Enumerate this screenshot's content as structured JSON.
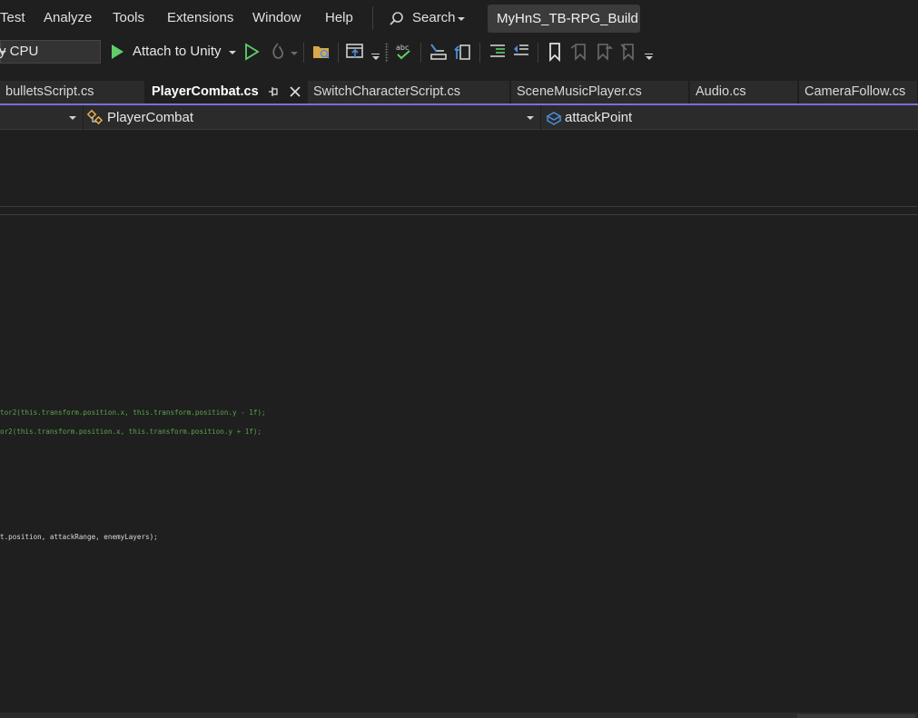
{
  "menubar": {
    "items": [
      "Test",
      "Analyze",
      "Tools",
      "Extensions",
      "Window",
      "Help"
    ],
    "search_label": "Search",
    "solution_name": "MyHnS_TB-RPG_Build"
  },
  "toolbar": {
    "platform": "y CPU",
    "attach_label": "Attach to Unity"
  },
  "tabs": [
    {
      "label": "bulletsScript.cs",
      "active": false
    },
    {
      "label": "PlayerCombat.cs",
      "active": true
    },
    {
      "label": "SwitchCharacterScript.cs",
      "active": false
    },
    {
      "label": "SceneMusicPlayer.cs",
      "active": false
    },
    {
      "label": "Audio.cs",
      "active": false
    },
    {
      "label": "CameraFollow.cs",
      "active": false
    }
  ],
  "navbar": {
    "type_member": "PlayerCombat",
    "member": "attackPoint"
  },
  "code": {
    "line1": "tor2(this.transform.position.x, this.transform.position.y - 1f);",
    "line2": "or2(this.transform.position.x, this.transform.position.y + 1f);",
    "line3": "t.position, attackRange, enemyLayers);"
  },
  "colors": {
    "accent": "#7a6fd6",
    "background": "#1f1f1f",
    "code_green": "#57a64a"
  }
}
